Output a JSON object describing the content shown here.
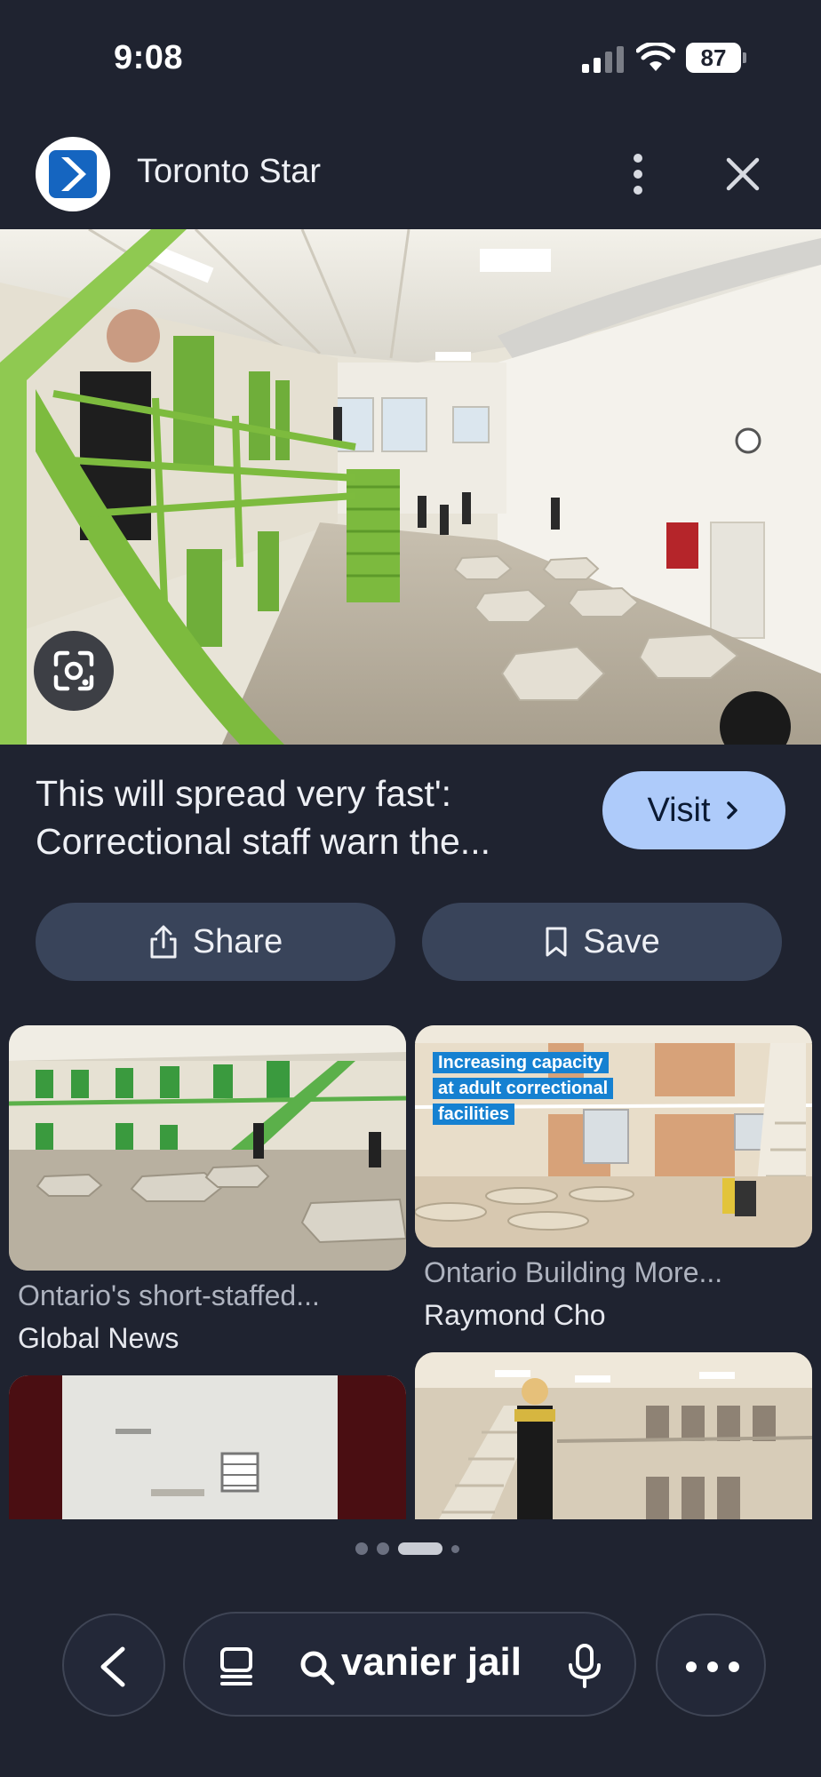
{
  "status_bar": {
    "time": "9:08",
    "battery": "87"
  },
  "header": {
    "source": "Toronto Star",
    "icons": [
      "more-vert-icon",
      "close-icon"
    ]
  },
  "result": {
    "caption": "This will spread very fast': Correctional staff warn the...",
    "visit_label": "Visit",
    "share_label": "Share",
    "save_label": "Save"
  },
  "related": [
    {
      "title": "Ontario's short-staffed...",
      "source": "Global News"
    },
    {
      "title": "Ontario Building More...",
      "source": "Raymond Cho",
      "overlay": "Increasing capacity at adult correctional facilities"
    }
  ],
  "search": {
    "query": "vanier jail"
  },
  "colors": {
    "background": "#1f2330",
    "visit_button": "#aecbfa",
    "secondary_button": "#39445a",
    "overlay_label": "#1681d1"
  }
}
